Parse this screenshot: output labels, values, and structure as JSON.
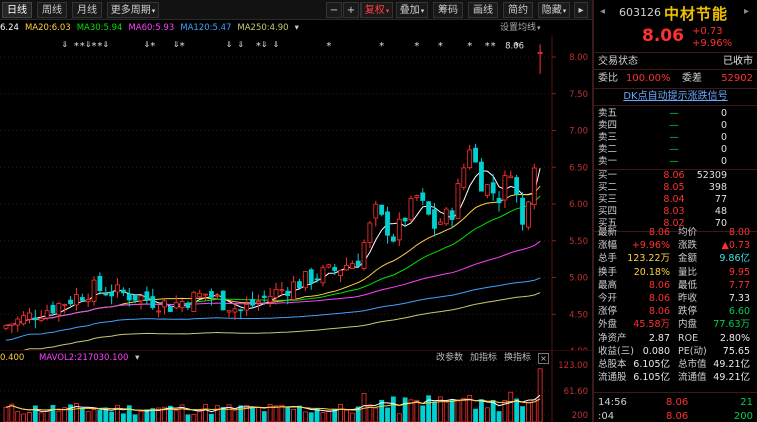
{
  "toolbar": {
    "tabs": [
      "日线",
      "周线",
      "月线",
      "更多周期"
    ],
    "more_caret": "▾",
    "buttons": {
      "minus": "−",
      "plus": "+",
      "left": "←",
      "fq": "复权",
      "overlay": "叠加",
      "chips": "筹码",
      "draw": "画线",
      "simple": "简约",
      "hide": "隐藏",
      "collapse": "▸"
    }
  },
  "ma": {
    "items": [
      {
        "text": "6.24",
        "color": "#ffffff"
      },
      {
        "text": "MA20:6.03",
        "color": "#ffd040"
      },
      {
        "text": "MA30:5.94",
        "color": "#00e000"
      },
      {
        "text": "MA60:5.93",
        "color": "#ff40ff"
      },
      {
        "text": "MA120:5.47",
        "color": "#40a0ff"
      },
      {
        "text": "MA250:4.90",
        "color": "#c8c870"
      }
    ],
    "down_arrow": "▾",
    "settings": "设置均线"
  },
  "markers": {
    "arrows": "⇓",
    "stars": "*",
    "price_label": "8.06"
  },
  "chart_data": {
    "type": "candlestick",
    "ylim": [
      4.0,
      8.0
    ],
    "yticks": [
      "8.00",
      "7.50",
      "7.00",
      "6.50",
      "6.00",
      "5.50",
      "5.00",
      "4.50",
      "4.00"
    ],
    "last_close": 8.06,
    "volume": {
      "yticks": [
        "123.00",
        "61.60",
        "200"
      ],
      "label": "MAVOL2:217030.100"
    }
  },
  "vol": {
    "left": "0.400",
    "mavol": "MAVOL2:217030.100",
    "buttons": [
      "改参数",
      "加指标",
      "换指标"
    ],
    "close": "×"
  },
  "panel": {
    "code": "603126",
    "name": "中材节能",
    "price": "8.06",
    "change": "+0.73",
    "change_pct": "+9.96%",
    "trade_status_label": "交易状态",
    "trade_status": "已收市",
    "weibi_label": "委比",
    "weibi": "100.00%",
    "weicha_label": "委差",
    "weicha": "52902",
    "dk": "DK点自动提示涨跌信号",
    "asks": [
      {
        "label": "卖五",
        "price": "—",
        "qty": "0"
      },
      {
        "label": "卖四",
        "price": "—",
        "qty": "0"
      },
      {
        "label": "卖三",
        "price": "—",
        "qty": "0"
      },
      {
        "label": "卖二",
        "price": "—",
        "qty": "0"
      },
      {
        "label": "卖一",
        "price": "—",
        "qty": "0"
      }
    ],
    "bids": [
      {
        "label": "买一",
        "price": "8.06",
        "qty": "52309"
      },
      {
        "label": "买二",
        "price": "8.05",
        "qty": "398"
      },
      {
        "label": "买三",
        "price": "8.04",
        "qty": "77"
      },
      {
        "label": "买四",
        "price": "8.03",
        "qty": "48"
      },
      {
        "label": "买五",
        "price": "8.02",
        "qty": "70"
      }
    ],
    "stats": [
      {
        "l1": "最新",
        "v1": "8.06",
        "c1": "red",
        "l2": "均价",
        "v2": "8.00",
        "c2": "red"
      },
      {
        "l1": "涨幅",
        "v1": "+9.96%",
        "c1": "red",
        "l2": "涨跌",
        "v2": "▲0.73",
        "c2": "red"
      },
      {
        "l1": "总手",
        "v1": "123.22万",
        "c1": "yel",
        "l2": "金额",
        "v2": "9.86亿",
        "c2": "cyan"
      },
      {
        "l1": "换手",
        "v1": "20.18%",
        "c1": "yel",
        "l2": "量比",
        "v2": "9.95",
        "c2": "red"
      },
      {
        "l1": "最高",
        "v1": "8.06",
        "c1": "red",
        "l2": "最低",
        "v2": "7.77",
        "c2": "red"
      },
      {
        "l1": "今开",
        "v1": "8.06",
        "c1": "red",
        "l2": "昨收",
        "v2": "7.33",
        "c2": "white"
      },
      {
        "l1": "涨停",
        "v1": "8.06",
        "c1": "red",
        "l2": "跌停",
        "v2": "6.60",
        "c2": "green"
      },
      {
        "l1": "外盘",
        "v1": "45.58万",
        "c1": "red",
        "l2": "内盘",
        "v2": "77.63万",
        "c2": "green"
      },
      {
        "l1": "净资产",
        "v1": "2.87",
        "c1": "white",
        "l2": "ROE",
        "v2": "2.80%",
        "c2": "white"
      },
      {
        "l1": "收益(三)",
        "v1": "0.080",
        "c1": "white",
        "l2": "PE(动)",
        "v2": "75.65",
        "c2": "white"
      },
      {
        "l1": "总股本",
        "v1": "6.105亿",
        "c1": "white",
        "l2": "总市值",
        "v2": "49.21亿",
        "c2": "white"
      },
      {
        "l1": "流通股",
        "v1": "6.105亿",
        "c1": "white",
        "l2": "流通值",
        "v2": "49.21亿",
        "c2": "white"
      }
    ],
    "ticks": [
      {
        "time": "14:56",
        "price": "8.06",
        "vol": "21"
      },
      {
        "time": ":04",
        "price": "8.06",
        "vol": "200"
      }
    ]
  },
  "colors": {
    "up": "#ff3030",
    "down": "#00d0d0",
    "bg": "#000000"
  }
}
